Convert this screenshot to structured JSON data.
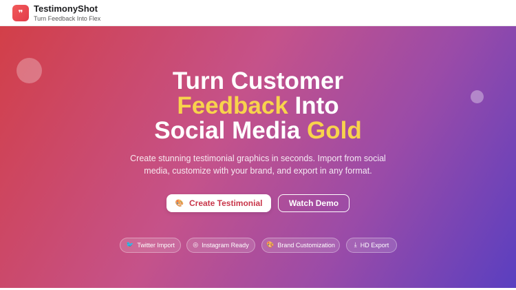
{
  "header": {
    "brand_icon": "quote-icon",
    "brand_icon_glyph": "❞",
    "brand_name": "TestimonyShot",
    "tagline": "Turn Feedback Into Flex"
  },
  "hero": {
    "headline_line1": "Turn Customer",
    "headline_line2_highlight": "Feedback",
    "headline_line2_rest": " Into",
    "headline_line3_rest": "Social Media ",
    "headline_line3_highlight": "Gold",
    "highlight_color": "#f8d34c",
    "subtext": "Create stunning testimonial graphics in seconds. Import from social media, customize with your brand, and export in any format.",
    "primary_button": {
      "label": "Create Testimonial",
      "icon": "palette-icon",
      "glyph": "🎨"
    },
    "secondary_button": {
      "label": "Watch Demo"
    },
    "features": [
      {
        "label": "Twitter Import",
        "icon": "twitter-icon",
        "glyph": "🐦"
      },
      {
        "label": "Instagram Ready",
        "icon": "instagram-icon",
        "glyph": "◎"
      },
      {
        "label": "Brand Customization",
        "icon": "palette-icon",
        "glyph": "🎨"
      },
      {
        "label": "HD Export",
        "icon": "download-icon",
        "glyph": "⤓"
      }
    ]
  },
  "colors": {
    "gradient_start": "#d23f48",
    "gradient_mid": "#c5528a",
    "gradient_end": "#5a3fc0",
    "brand_red": "#e23c4a"
  }
}
